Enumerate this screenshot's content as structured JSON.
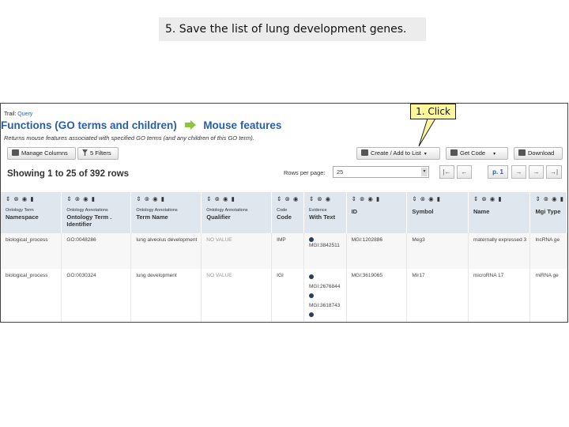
{
  "slide": {
    "step_text": "5. Save the list of lung development genes.",
    "callout_text": "1. Click"
  },
  "app": {
    "trail_label": "Trail:",
    "trail_link": "Query",
    "heading_left": "Functions (GO terms and children)",
    "heading_right": "Mouse features",
    "subtitle": "Returns mouse features associated with specified GO terms (and any children of this GO term).",
    "arrow_color": "#8cc63f",
    "accent_color": "#2a5fa8"
  },
  "toolbar": {
    "manage_columns": "Manage Columns",
    "filters": "5 Filters",
    "create_add_list": "Create / Add to List",
    "get_code": "Get Code",
    "download": "Download"
  },
  "results": {
    "showing": "Showing 1 to 25 of 392 rows",
    "rows_per_page_label": "Rows per page:",
    "rows_per_page_value": "25",
    "pager": {
      "first": "|←",
      "prev": "←",
      "page": "p. 1",
      "next": "→",
      "next2": "→",
      "last": "→|"
    }
  },
  "table": {
    "columns": [
      {
        "small": "Ontology Term",
        "main": "Namespace",
        "icons": "⇕ ⊗ ◉ ▮"
      },
      {
        "small": "Ontology Annotations",
        "main": "Ontology Term . Identifier",
        "icons": "⇕ ⊗ ◉ ▮"
      },
      {
        "small": "Ontology Annotations",
        "main": "Term Name",
        "icons": "⇕ ⊗ ◉ ▮"
      },
      {
        "small": "Ontology Annotations",
        "main": "Qualifier",
        "icons": "⇕ ⊗ ◉ ▮"
      },
      {
        "small": "Code",
        "main": "Code",
        "icons": "⇕ ⊗ ◉"
      },
      {
        "small": "Evidence",
        "main": "With Text",
        "icons": "⇕ ⊗ ◉"
      },
      {
        "small": "",
        "main": "ID",
        "icons": "⇕ ⊗ ◉ ▮"
      },
      {
        "small": "",
        "main": "Symbol",
        "icons": "⇕ ⊗ ◉ ▮"
      },
      {
        "small": "",
        "main": "Name",
        "icons": "⇕ ⊗ ◉ ▮"
      },
      {
        "small": "",
        "main": "Mgi Type",
        "icons": "⇕ ⊗ ◉ ▮"
      }
    ],
    "rows": [
      {
        "namespace": "biological_process",
        "go_id": "GO:0048286",
        "term_name": "lung alveolus development",
        "qualifier": "NO VALUE",
        "code": "IMP",
        "with_text": [
          "MGI:3842511"
        ],
        "id": "MGI:1202886",
        "symbol": "Meg3",
        "name": "maternally expressed 3",
        "mgi_type": "lncRNA ge"
      },
      {
        "namespace": "biological_process",
        "go_id": "GO:0030324",
        "term_name": "lung development",
        "qualifier": "NO VALUE",
        "code": "IGI",
        "with_text": [
          "MGI:2676844",
          "MGI:3618743"
        ],
        "id": "MGI:3619065",
        "symbol": "Mir17",
        "name": "microRNA 17",
        "mgi_type": "miRNA ge"
      }
    ]
  }
}
